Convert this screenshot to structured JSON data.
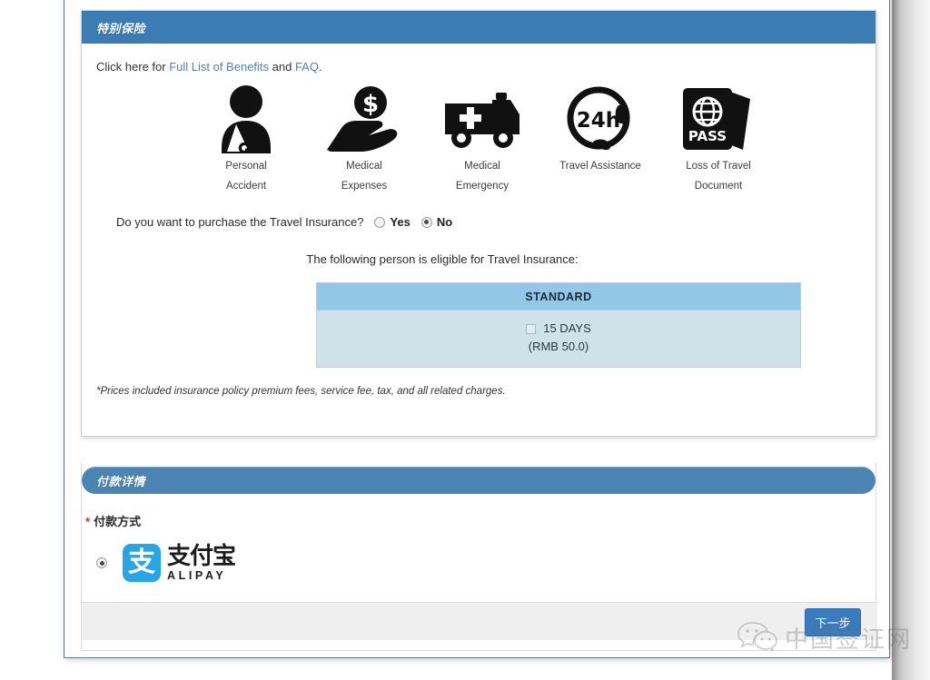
{
  "insurance_panel": {
    "header_title": "特别保险",
    "links_line": {
      "prefix": "Click here for ",
      "link1": "Full List of Benefits",
      "middle": " and ",
      "link2": "FAQ",
      "suffix": "."
    },
    "benefits": [
      {
        "icon": "personal-accident-icon",
        "line1": "Personal",
        "line2": "Accident"
      },
      {
        "icon": "medical-expenses-icon",
        "line1": "Medical",
        "line2": "Expenses"
      },
      {
        "icon": "medical-emergency-icon",
        "line1": "Medical",
        "line2": "Emergency"
      },
      {
        "icon": "travel-assistance-24h-icon",
        "line1": "Travel Assistance",
        "line2": ""
      },
      {
        "icon": "loss-of-travel-document-icon",
        "line1": "Loss of Travel",
        "line2": "Document"
      }
    ],
    "question": {
      "text": "Do you want to purchase the Travel Insurance?",
      "yes_label": "Yes",
      "no_label": "No",
      "selected": "No"
    },
    "eligible_text": "The following person is eligible for Travel Insurance:",
    "plan_table": {
      "header": "STANDARD",
      "row_duration": "15 DAYS",
      "row_price": "(RMB 50.0)",
      "checked": false
    },
    "fineprint": "*Prices included insurance policy premium fees, service fee, tax, and all related charges."
  },
  "payment_panel": {
    "header_title": "付款详情",
    "required_marker": "*",
    "field_label": "付款方式",
    "option": {
      "selected": true,
      "logo_mark": "支",
      "logo_cn": "支付宝",
      "logo_en": "ALIPAY"
    },
    "next_button_label": "下一步"
  },
  "watermark": {
    "icon": "wechat-icon",
    "text": "中国签证网"
  },
  "colors": {
    "header_blue": "#3b7cb5",
    "header_round_blue": "#4c85b4",
    "link_blue": "#4a83bd",
    "table_head_blue": "#92c7e8",
    "table_row_blue": "#cfe2ea",
    "alipay_blue": "#27a5e4",
    "required_red": "#d2322d",
    "button_blue": "#3a7bbd"
  }
}
